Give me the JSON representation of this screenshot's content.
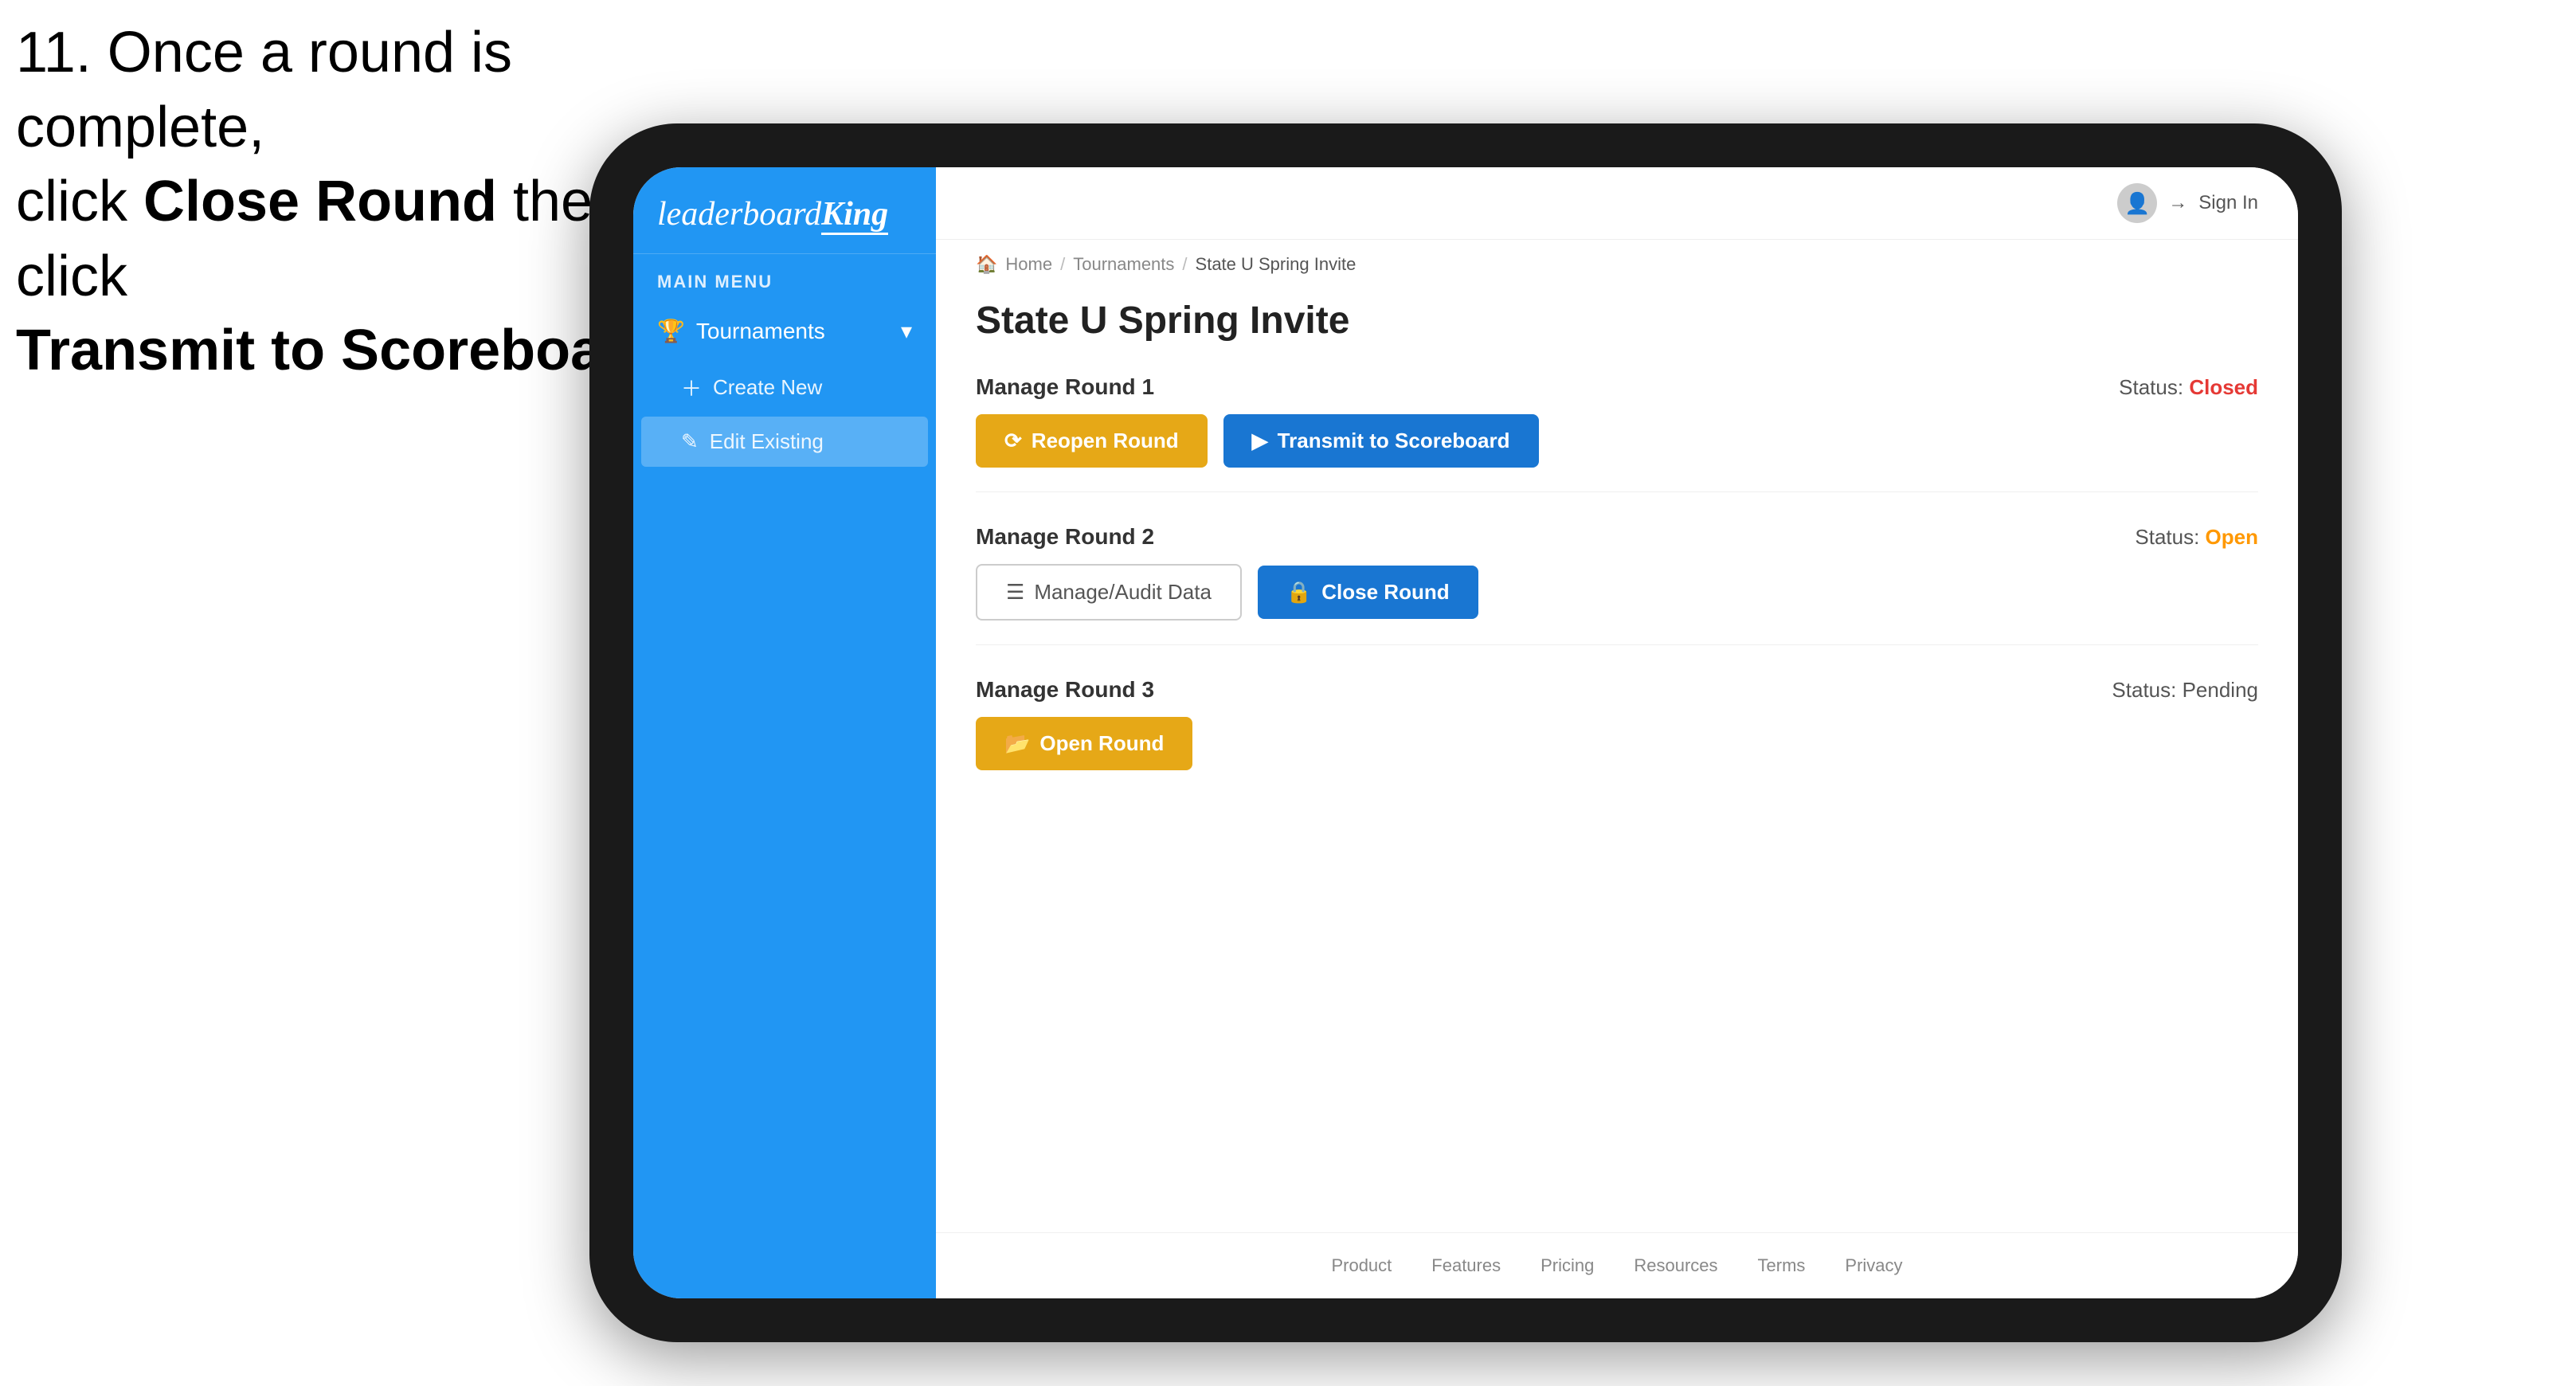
{
  "instruction": {
    "number": "11.",
    "line1": "Once a round is complete,",
    "line2_prefix": "click ",
    "line2_bold": "Close Round",
    "line2_suffix": " then click",
    "line3_bold": "Transmit to Scoreboard."
  },
  "app": {
    "logo": {
      "leaderboard": "leaderboard",
      "king": "King"
    },
    "mainMenuLabel": "MAIN MENU",
    "sidebar": {
      "tournaments": {
        "label": "Tournaments",
        "expanded": true
      },
      "createNew": {
        "label": "Create New"
      },
      "editExisting": {
        "label": "Edit Existing",
        "active": true
      }
    },
    "topBar": {
      "signIn": "Sign In"
    },
    "breadcrumb": {
      "home": "Home",
      "tournaments": "Tournaments",
      "current": "State U Spring Invite"
    },
    "pageTitle": "State U Spring Invite",
    "rounds": [
      {
        "id": "round1",
        "label": "Manage Round 1",
        "statusLabel": "Status:",
        "statusText": "Closed",
        "statusClass": "status-closed",
        "leftButton": {
          "label": "Reopen Round",
          "style": "btn-gold",
          "icon": "⟳"
        },
        "rightButton": {
          "label": "Transmit to Scoreboard",
          "style": "btn-blue",
          "icon": "▶"
        }
      },
      {
        "id": "round2",
        "label": "Manage Round 2",
        "statusLabel": "Status:",
        "statusText": "Open",
        "statusClass": "status-open",
        "leftButton": {
          "label": "Manage/Audit Data",
          "style": "btn-gray-outline",
          "icon": "☰"
        },
        "rightButton": {
          "label": "Close Round",
          "style": "btn-blue",
          "icon": "🔒"
        }
      },
      {
        "id": "round3",
        "label": "Manage Round 3",
        "statusLabel": "Status:",
        "statusText": "Pending",
        "statusClass": "status-pending",
        "leftButton": {
          "label": "Open Round",
          "style": "btn-gold",
          "icon": "📂"
        },
        "rightButton": null
      }
    ],
    "footer": {
      "links": [
        "Product",
        "Features",
        "Pricing",
        "Resources",
        "Terms",
        "Privacy"
      ]
    }
  }
}
